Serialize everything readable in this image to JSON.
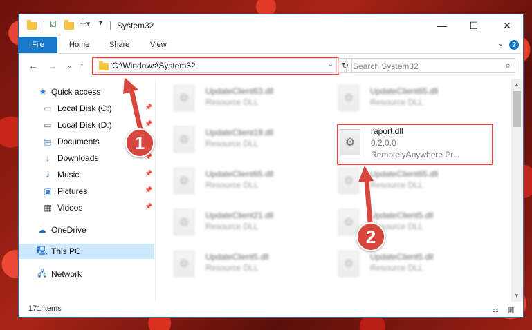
{
  "window": {
    "title": "System32",
    "minimize": "—",
    "maximize": "☐",
    "close": "✕"
  },
  "ribbon": {
    "file": "File",
    "tabs": [
      "Home",
      "Share",
      "View"
    ],
    "help": "?"
  },
  "address": {
    "path": "C:\\Windows\\System32",
    "search_placeholder": "Search System32"
  },
  "sidebar": {
    "items": [
      {
        "label": "Quick access",
        "icon": "star-icon"
      },
      {
        "label": "Local Disk (C:)",
        "icon": "drive-icon"
      },
      {
        "label": "Local Disk (D:)",
        "icon": "drive-icon"
      },
      {
        "label": "Documents",
        "icon": "documents-icon"
      },
      {
        "label": "Downloads",
        "icon": "download-icon"
      },
      {
        "label": "Music",
        "icon": "music-icon"
      },
      {
        "label": "Pictures",
        "icon": "pictures-icon"
      },
      {
        "label": "Videos",
        "icon": "videos-icon"
      },
      {
        "label": "OneDrive",
        "icon": "cloud-icon"
      },
      {
        "label": "This PC",
        "icon": "computer-icon"
      },
      {
        "label": "Network",
        "icon": "network-icon"
      }
    ]
  },
  "files": {
    "left": [
      {
        "name": "UpdateClient63.dll",
        "type": "Resource DLL"
      },
      {
        "name": "UpdateClient19.dll",
        "type": "Resource DLL"
      },
      {
        "name": "UpdateClient65.dll",
        "type": "Resource DLL"
      },
      {
        "name": "UpdateClient21.dll",
        "type": "Resource DLL"
      },
      {
        "name": "UpdateClient5.dll",
        "type": "Resource DLL"
      }
    ],
    "right": [
      {
        "name": "UpdateClient65.dll",
        "type": "Resource DLL"
      },
      {
        "name": "raport.dll",
        "type": "0.2.0.0",
        "desc": "RemotelyAnywhere Pr..."
      },
      {
        "name": "UpdateClient65.dll",
        "type": "Resource DLL"
      },
      {
        "name": "UpdateClient5.dll",
        "type": "Resource DLL"
      },
      {
        "name": "UpdateClient5.dll",
        "type": "Resource DLL"
      }
    ]
  },
  "status": {
    "count": "171 items"
  },
  "callouts": {
    "one": "1",
    "two": "2"
  },
  "colors": {
    "accent": "#1979ca",
    "highlight": "#d9484a"
  }
}
